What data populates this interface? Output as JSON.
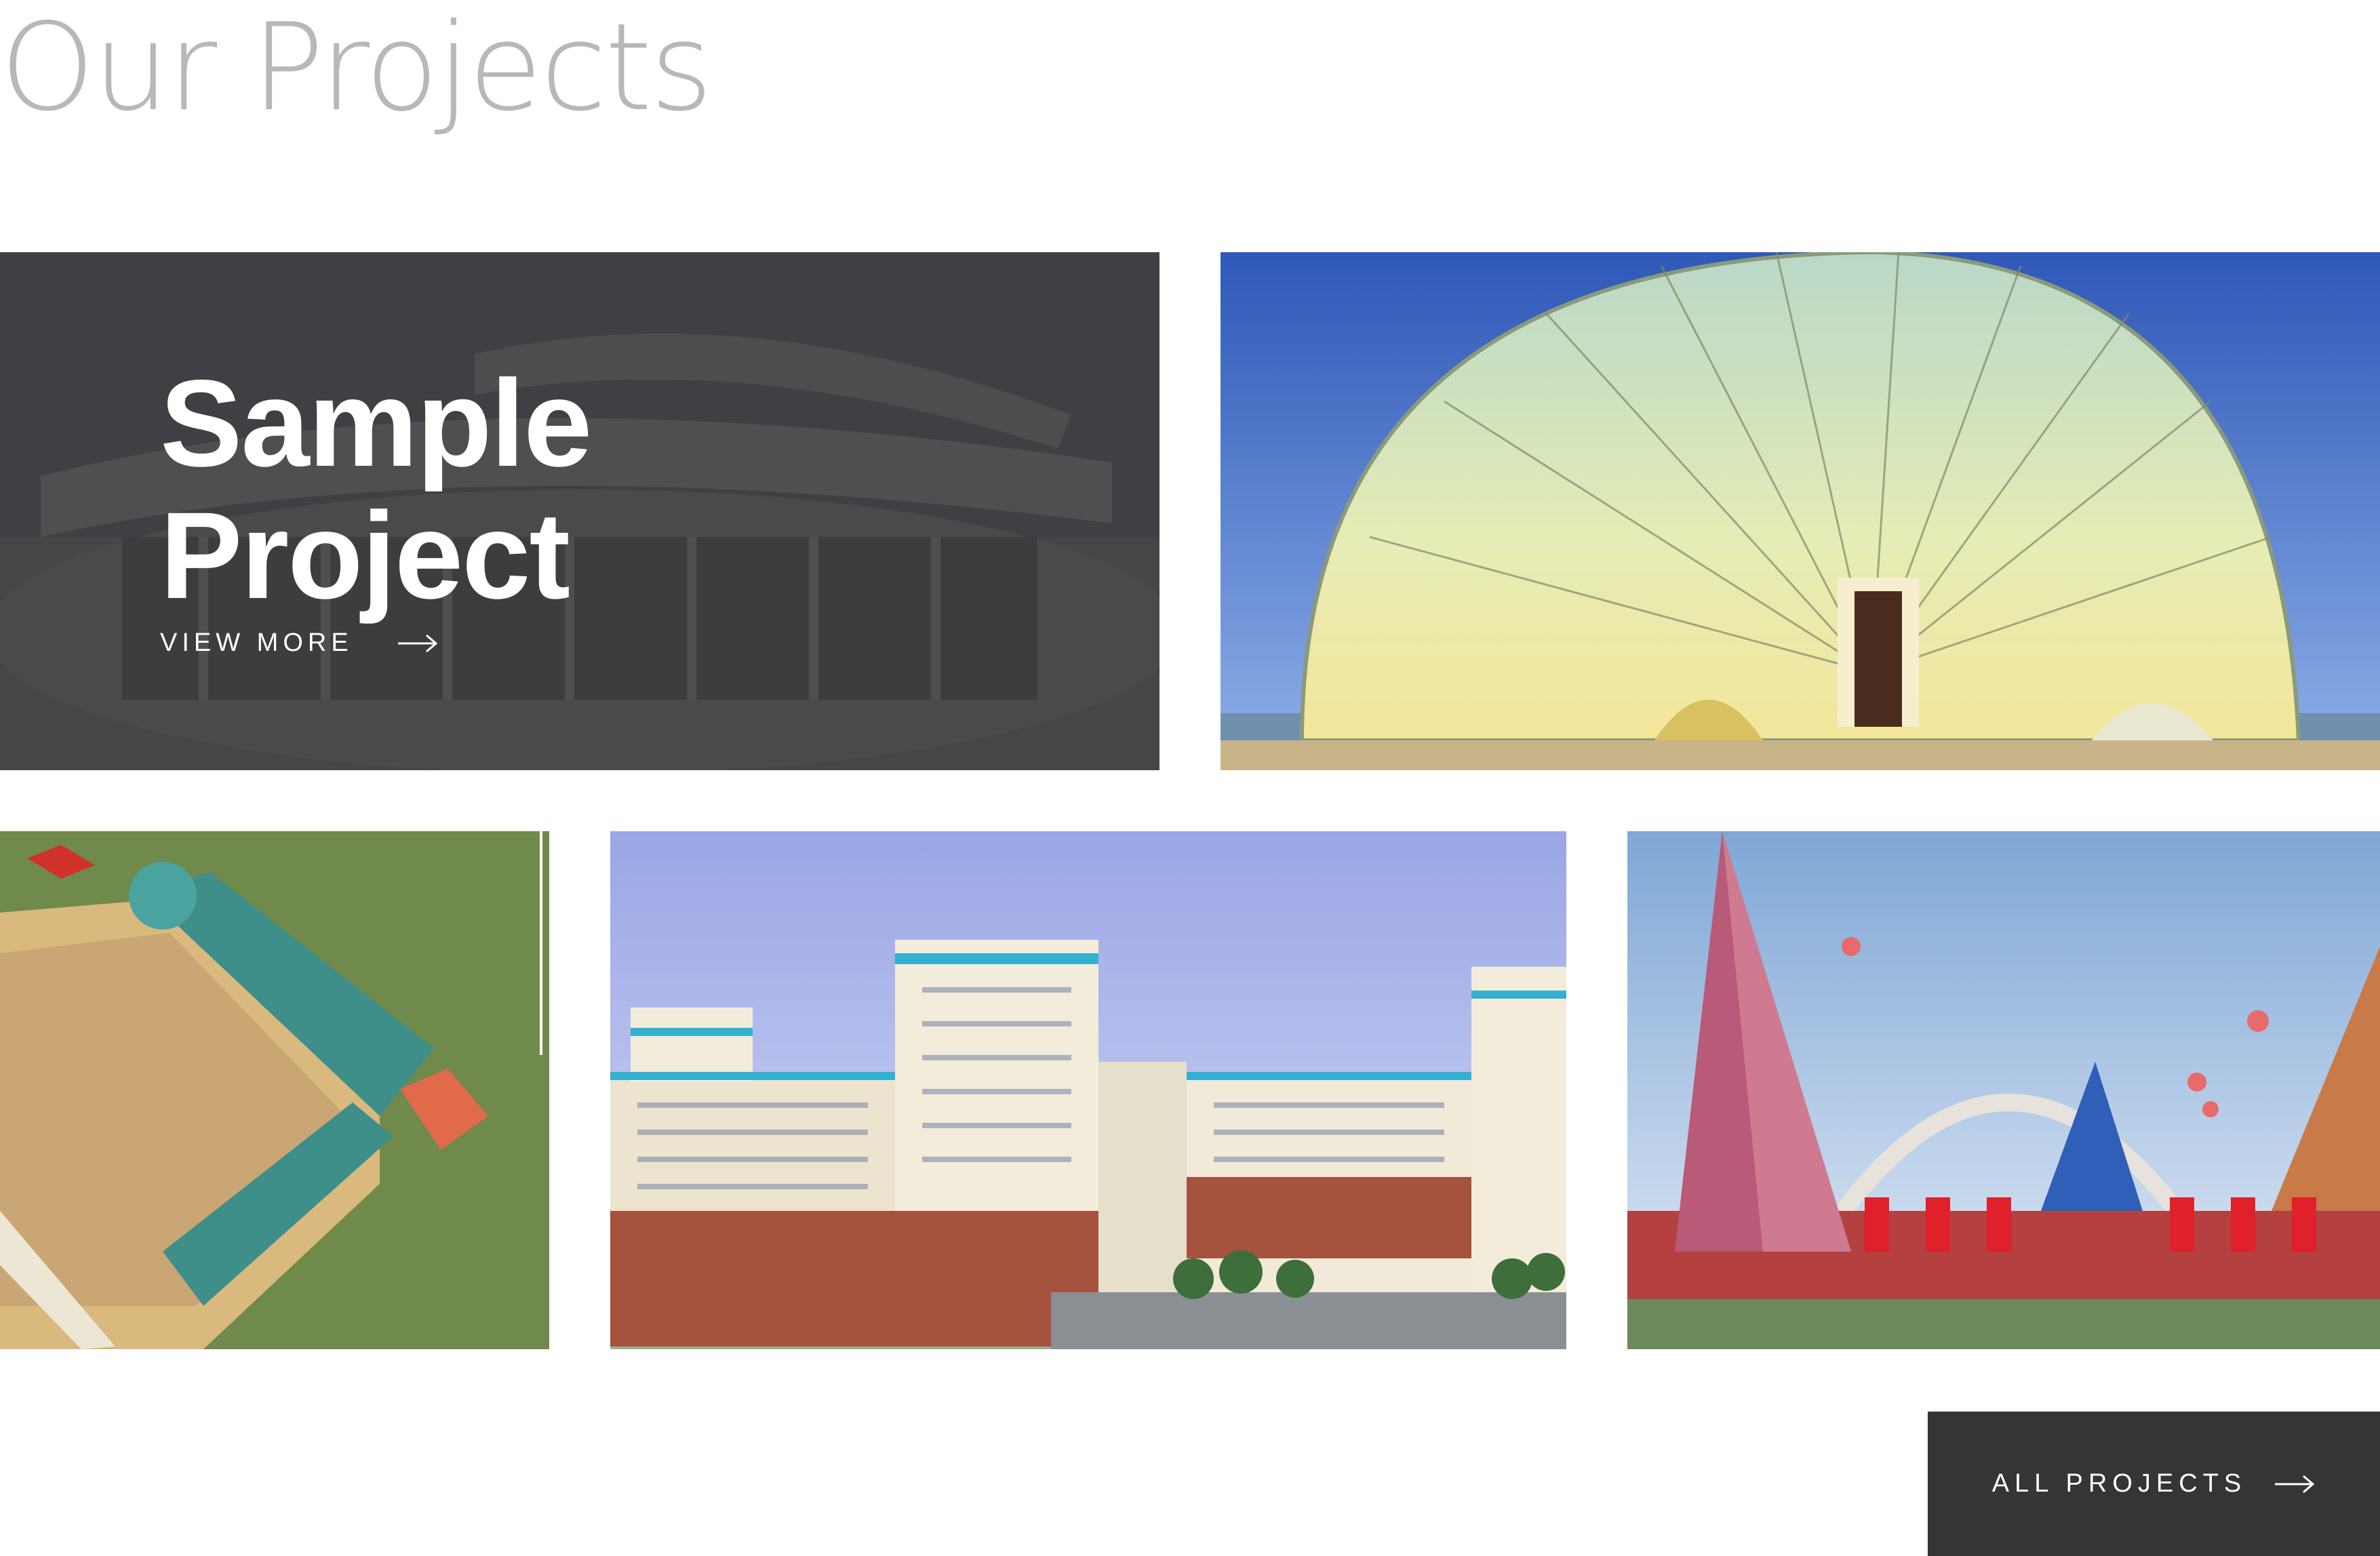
{
  "section": {
    "title": "Our Projects"
  },
  "featured": {
    "title_line1": "Sample",
    "title_line2": "Project",
    "link_label": "VIEW MORE",
    "link_icon": "arrow-right-icon"
  },
  "projects": [
    {
      "image": "stadium-aerial"
    },
    {
      "image": "dome-building"
    },
    {
      "image": "sports-complex-aerial"
    },
    {
      "image": "apartment-towers"
    },
    {
      "image": "pyramid-arch-monument"
    }
  ],
  "footer": {
    "all_projects_label": "ALL PROJECTS",
    "all_projects_icon": "arrow-right-icon"
  },
  "colors": {
    "overlay": "#37383a",
    "button_bg": "#343535",
    "title_gray": "#b8b8b8"
  }
}
